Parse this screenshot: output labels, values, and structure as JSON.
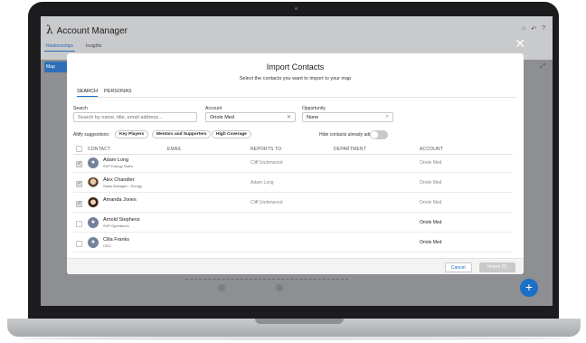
{
  "app": {
    "title": "Account Manager",
    "logo_glyph": "λ",
    "tabs": [
      "Relationships",
      "Insights"
    ],
    "map_button": "Map",
    "header_icons": [
      "⌂",
      "↶",
      "?"
    ],
    "close_glyph": "✕",
    "fab_glyph": "+"
  },
  "modal": {
    "title": "Import Contacts",
    "subtitle": "Select the contacts you want to import to your map",
    "tabs": [
      "SEARCH",
      "PERSONAS"
    ],
    "search": {
      "label": "Search",
      "placeholder": "Search by name, title, email address..."
    },
    "account": {
      "label": "Account",
      "value": "Oriole Med",
      "clear_glyph": "✕"
    },
    "opportunity": {
      "label": "Opportunity",
      "value": "None",
      "icon_glyph": "⌕"
    },
    "suggestions": {
      "label": "Altify suggestions:",
      "pills": [
        "Key Players",
        "Mentors and Supporters",
        "High Coverage"
      ],
      "hide_label": "Hide contacts already added",
      "hide_on": false
    },
    "columns": [
      "CONTACT",
      "EMAIL",
      "REPORTS TO",
      "DEPARTMENT",
      "ACCOUNT"
    ],
    "rows": [
      {
        "name": "Adam Long",
        "title": "SVP Energy Sales",
        "reports_to": "Cliff Underwood",
        "account": "Oriole Med",
        "checked": true,
        "added": true,
        "avatar": "initial"
      },
      {
        "name": "Alex Chandler",
        "title": "Sales Manager - Energy",
        "reports_to": "Adam Long",
        "account": "Oriole Med",
        "checked": true,
        "added": true,
        "avatar": "photo1"
      },
      {
        "name": "Amanda Jones",
        "title": "",
        "reports_to": "Cliff Underwood",
        "account": "Oriole Med",
        "checked": true,
        "added": true,
        "avatar": "photo2"
      },
      {
        "name": "Arnold Stephens",
        "title": "SVP Operations",
        "reports_to": "",
        "account": "Oriole Med",
        "checked": false,
        "added": false,
        "avatar": "initial"
      },
      {
        "name": "Cilla Franks",
        "title": "CEO",
        "reports_to": "",
        "account": "Oriole Med",
        "checked": false,
        "added": false,
        "avatar": "initial"
      }
    ],
    "footer": {
      "cancel": "Cancel",
      "import": "Import (0)"
    }
  }
}
